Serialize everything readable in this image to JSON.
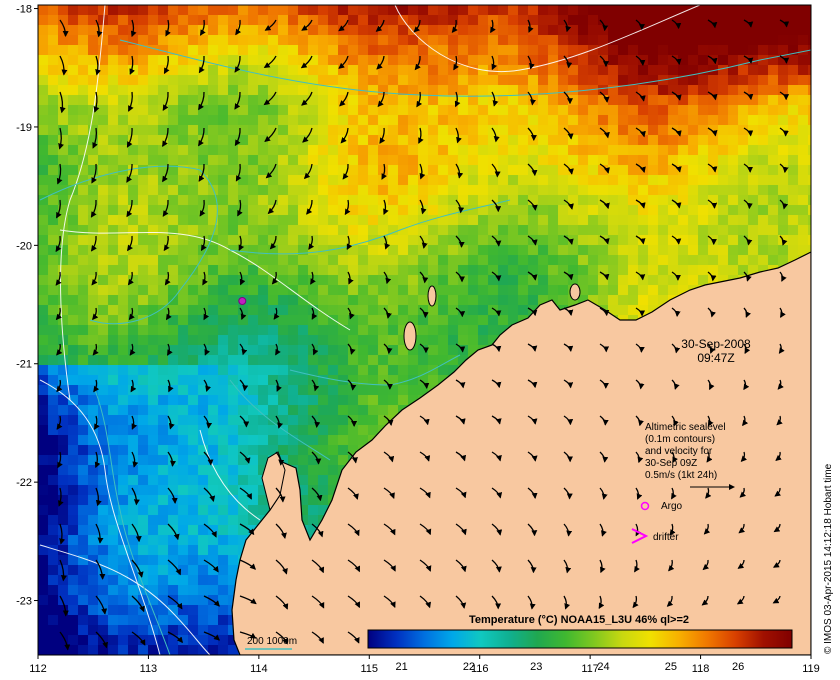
{
  "date": {
    "line1": "30-Sep-2008",
    "line2": "09:47Z"
  },
  "legend": {
    "lines": [
      "Altimetric sealevel",
      "(0.1m contours)",
      "and velocity for",
      "30-Sep 09Z",
      "0.5m/s (1kt 24h)"
    ],
    "argo": "Argo",
    "drifter": "drifter",
    "argo_color": "#ff00ff",
    "drifter_color": "#ff00ff"
  },
  "bathymetry": {
    "label": "200  1000m",
    "color": "#40c0c0"
  },
  "colorbar": {
    "title": "Temperature (°C) NOAA15_L3U 46% ql>=2",
    "ticks": [
      "21",
      "22",
      "23",
      "24",
      "25",
      "26"
    ],
    "range": [
      20.5,
      26.8
    ],
    "colors": [
      "#000080",
      "#0030c0",
      "#0070e0",
      "#00a8e8",
      "#10c8c0",
      "#10b090",
      "#20a850",
      "#40b830",
      "#80c820",
      "#c8d810",
      "#f0e000",
      "#f8b000",
      "#f07800",
      "#d84000",
      "#a01000",
      "#800000"
    ]
  },
  "axes": {
    "x_ticks": [
      "112",
      "113",
      "114",
      "115",
      "116",
      "117",
      "118",
      "119"
    ],
    "y_ticks": [
      "-18",
      "-19",
      "-20",
      "-21",
      "-22",
      "-23"
    ]
  },
  "credit": "© IMOS 03-Apr-2015 14:12:18 Hobart time",
  "colors": {
    "land": "#f8c8a0",
    "coast": "#000000"
  },
  "argo_position": [
    113.85,
    -20.47
  ]
}
